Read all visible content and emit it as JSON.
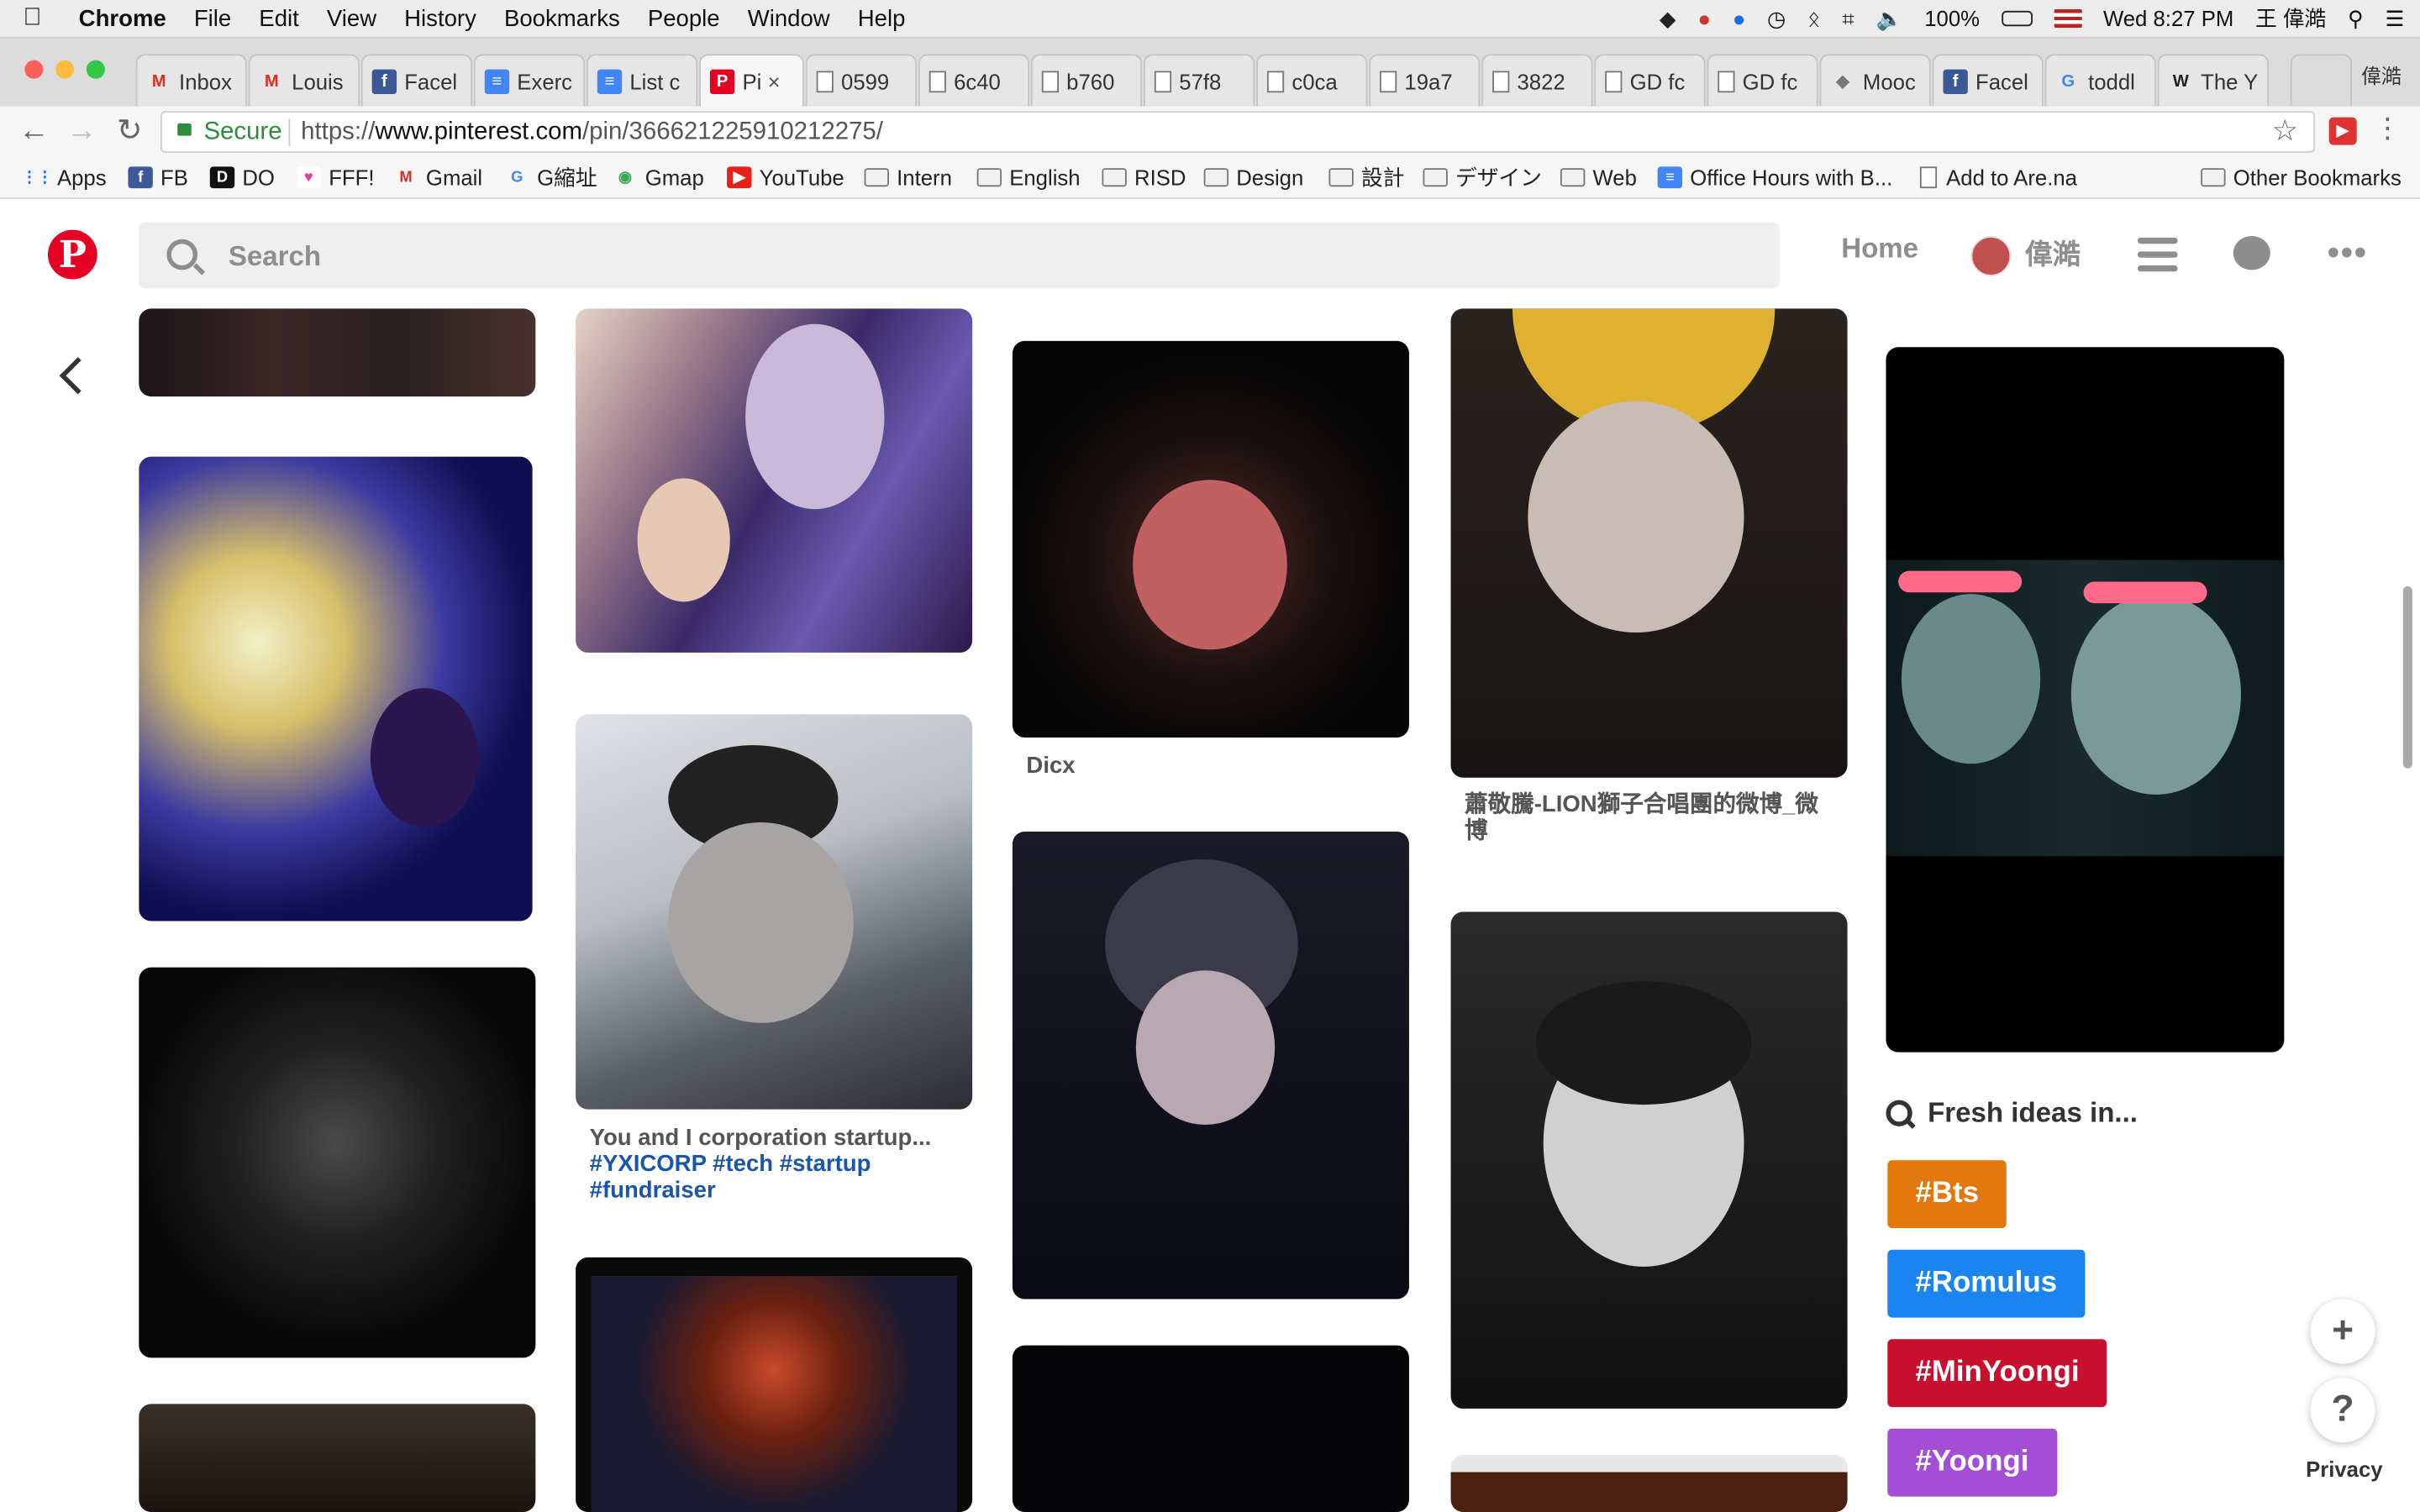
{
  "menubar": {
    "app": "Chrome",
    "items": [
      "File",
      "Edit",
      "View",
      "History",
      "Bookmarks",
      "People",
      "Window",
      "Help"
    ],
    "battery": "100%",
    "datetime": "Wed 8:27 PM",
    "user": "王 偉澔"
  },
  "tabs": [
    {
      "label": "Inbox",
      "icon": "gmail-icon"
    },
    {
      "label": "Louis",
      "icon": "gmail-icon"
    },
    {
      "label": "Facel",
      "icon": "facebook-icon"
    },
    {
      "label": "Exerc",
      "icon": "docs-icon"
    },
    {
      "label": "List c",
      "icon": "docs-icon"
    },
    {
      "label": "Pi",
      "icon": "pinterest-icon",
      "active": true
    },
    {
      "label": "0599",
      "icon": "page-icon"
    },
    {
      "label": "6c40",
      "icon": "page-icon"
    },
    {
      "label": "b760",
      "icon": "page-icon"
    },
    {
      "label": "57f8",
      "icon": "page-icon"
    },
    {
      "label": "c0ca",
      "icon": "page-icon"
    },
    {
      "label": "19a7",
      "icon": "page-icon"
    },
    {
      "label": "3822",
      "icon": "page-icon"
    },
    {
      "label": "GD fc",
      "icon": "page-icon"
    },
    {
      "label": "GD fc",
      "icon": "page-icon"
    },
    {
      "label": "Mooc",
      "icon": "mooc-icon"
    },
    {
      "label": "Facel",
      "icon": "facebook-icon"
    },
    {
      "label": "toddl",
      "icon": "google-icon"
    },
    {
      "label": "The Y",
      "icon": "wikipedia-icon"
    }
  ],
  "profile_name": "偉澔",
  "address": {
    "secure_label": "Secure",
    "scheme": "https://",
    "host": "www.pinterest.com",
    "path": "/pin/366621225910212275/"
  },
  "bookmarks": [
    {
      "label": "Apps",
      "icon": "apps-icon"
    },
    {
      "label": "FB",
      "icon": "facebook-icon"
    },
    {
      "label": "DO",
      "icon": "do-icon"
    },
    {
      "label": "FFF!",
      "icon": "heart-icon"
    },
    {
      "label": "Gmail",
      "icon": "gmail-icon"
    },
    {
      "label": "G縮址",
      "icon": "google-icon"
    },
    {
      "label": "Gmap",
      "icon": "maps-icon"
    },
    {
      "label": "YouTube",
      "icon": "youtube-icon"
    },
    {
      "label": "Intern",
      "icon": "folder-icon"
    },
    {
      "label": "English",
      "icon": "folder-icon"
    },
    {
      "label": "RISD",
      "icon": "folder-icon"
    },
    {
      "label": "Design",
      "icon": "folder-icon"
    },
    {
      "label": "設計",
      "icon": "folder-icon"
    },
    {
      "label": "デザイン",
      "icon": "folder-icon"
    },
    {
      "label": "Web",
      "icon": "folder-icon"
    },
    {
      "label": "Office Hours with B...",
      "icon": "docs-icon"
    },
    {
      "label": "Add to Are.na",
      "icon": "page-icon"
    },
    {
      "label": "Other Bookmarks",
      "icon": "folder-icon"
    }
  ],
  "pinterest": {
    "search_placeholder": "Search",
    "nav_home": "Home",
    "user_name": "偉澔"
  },
  "pins": {
    "dicx_caption": "Dicx",
    "lion_caption": "蕭敬騰-LION獅子合唱團的微博_微博",
    "corp_caption_text": "You and I corporation startup... ",
    "corp_caption_tags": "#YXICORP #tech #startup #fundraiser"
  },
  "fresh_ideas": {
    "heading": "Fresh ideas in...",
    "chips": [
      {
        "label": "#Bts",
        "color": "#e3780c"
      },
      {
        "label": "#Romulus",
        "color": "#1b84ef"
      },
      {
        "label": "#MinYoongi",
        "color": "#c8102e"
      },
      {
        "label": "#Yoongi",
        "color": "#a44ed6"
      }
    ]
  },
  "privacy_label": "Privacy",
  "colors": {
    "pinterest_red": "#e60023",
    "secure_green": "#2d8d3a",
    "tag_blue": "#1a55a8"
  }
}
